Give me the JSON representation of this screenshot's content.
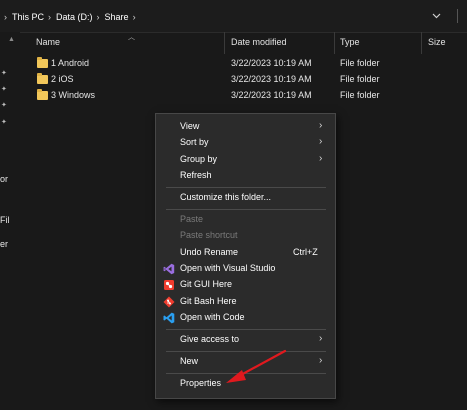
{
  "address": {
    "crumbs": [
      "This PC",
      "Data (D:)",
      "Share"
    ]
  },
  "nav": {
    "partial_labels": [
      "or",
      "Fil",
      "er"
    ]
  },
  "columns": {
    "name": "Name",
    "date": "Date modified",
    "type": "Type",
    "size": "Size"
  },
  "files": [
    {
      "name": "1 Android",
      "date": "3/22/2023 10:19 AM",
      "type": "File folder",
      "size": ""
    },
    {
      "name": "2 iOS",
      "date": "3/22/2023 10:19 AM",
      "type": "File folder",
      "size": ""
    },
    {
      "name": "3 Windows",
      "date": "3/22/2023 10:19 AM",
      "type": "File folder",
      "size": ""
    }
  ],
  "menu": {
    "items": [
      {
        "label": "View",
        "submenu": true
      },
      {
        "label": "Sort by",
        "submenu": true
      },
      {
        "label": "Group by",
        "submenu": true
      },
      {
        "label": "Refresh"
      },
      {
        "label": "Customize this folder..."
      },
      {
        "label": "Paste",
        "disabled": true
      },
      {
        "label": "Paste shortcut",
        "disabled": true
      },
      {
        "label": "Undo Rename",
        "shortcut": "Ctrl+Z"
      },
      {
        "label": "Open with Visual Studio",
        "icon": "visual-studio-icon"
      },
      {
        "label": "Git GUI Here",
        "icon": "git-gui-icon"
      },
      {
        "label": "Git Bash Here",
        "icon": "git-bash-icon"
      },
      {
        "label": "Open with Code",
        "icon": "vscode-icon"
      },
      {
        "label": "Give access to",
        "submenu": true
      },
      {
        "label": "New",
        "submenu": true
      },
      {
        "label": "Properties"
      }
    ]
  },
  "colors": {
    "background": "#191919",
    "menu_background": "#2b2b2b",
    "annotation_arrow": "#e0191e",
    "folder": "#f2c75a"
  }
}
